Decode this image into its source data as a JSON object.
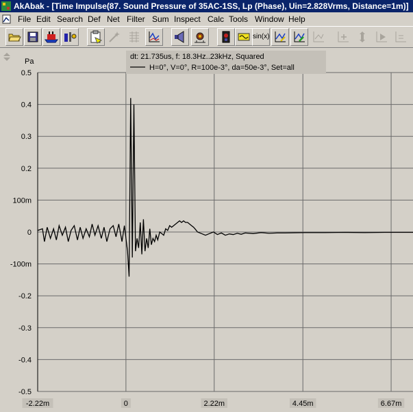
{
  "window": {
    "title": "AkAbak - [Time Impulse(87. Sound Pressure of 35AC-1SS, Lp (Phase), Uin=2.828Vrms, Distance=1m)]"
  },
  "menu": {
    "items": [
      "File",
      "Edit",
      "Search",
      "Def",
      "Net",
      "Filter",
      "Sum",
      "Inspect",
      "Calc",
      "Tools",
      "Window",
      "Help"
    ]
  },
  "toolbar": {
    "sinx_label": "sin(x)",
    "buttons": [
      {
        "name": "open-icon",
        "enabled": true
      },
      {
        "name": "save-icon",
        "enabled": true
      },
      {
        "name": "ship-icon",
        "enabled": true
      },
      {
        "name": "speaker-icon",
        "enabled": true
      },
      {
        "name": "clipboard-icon",
        "enabled": true
      },
      {
        "name": "wand-icon",
        "enabled": false
      },
      {
        "name": "grid-icon",
        "enabled": false
      },
      {
        "name": "graph-icon",
        "enabled": true
      },
      {
        "name": "driver-icon",
        "enabled": true
      },
      {
        "name": "speaker-box-icon",
        "enabled": true
      },
      {
        "name": "phone-icon",
        "enabled": true
      },
      {
        "name": "filter-icon",
        "enabled": true
      },
      {
        "name": "sinx-icon",
        "enabled": true
      },
      {
        "name": "arrow-graph-icon",
        "enabled": true
      },
      {
        "name": "green-graph-icon",
        "enabled": true
      },
      {
        "name": "pen-graph-icon",
        "enabled": false
      },
      {
        "name": "move-icon",
        "enabled": false
      },
      {
        "name": "zoom-icon",
        "enabled": false
      },
      {
        "name": "play-icon",
        "enabled": false
      },
      {
        "name": "export-icon",
        "enabled": false
      }
    ]
  },
  "colors": {
    "face": "#d4d0c8",
    "title_bar": "#0a246a",
    "grid": "#6a6a6a",
    "trace": "#000000",
    "legend_bg": "#c4c0b8"
  },
  "chart_data": {
    "type": "line",
    "ylabel": "Pa",
    "legend": {
      "header": "dt: 21.735us, f: 18.3Hz..23kHz, Squared",
      "series_name": "H=0°, V=0°, R=100e-3°, da=50e-3°, Set=all",
      "placement": "top-center"
    },
    "x_ticks": [
      {
        "value": -0.00222,
        "label": "-2.22m"
      },
      {
        "value": 0,
        "label": "0"
      },
      {
        "value": 0.00222,
        "label": "2.22m"
      },
      {
        "value": 0.00445,
        "label": "4.45m"
      },
      {
        "value": 0.00667,
        "label": "6.67m"
      }
    ],
    "y_ticks": [
      {
        "value": 0.5,
        "label": "0.5"
      },
      {
        "value": 0.4,
        "label": "0.4"
      },
      {
        "value": 0.3,
        "label": "0.3"
      },
      {
        "value": 0.2,
        "label": "0.2"
      },
      {
        "value": 0.1,
        "label": "100m"
      },
      {
        "value": 0,
        "label": "0"
      },
      {
        "value": -0.1,
        "label": "-100m"
      },
      {
        "value": -0.2,
        "label": "-0.2"
      },
      {
        "value": -0.3,
        "label": "-0.3"
      },
      {
        "value": -0.4,
        "label": "-0.4"
      },
      {
        "value": -0.5,
        "label": "-0.5"
      }
    ],
    "xlim": [
      -0.00222,
      0.00722
    ],
    "ylim": [
      -0.5,
      0.5
    ],
    "grid": true,
    "series": [
      {
        "x": [
          -0.00222,
          -0.0021,
          -0.00205,
          -0.00198,
          -0.0019,
          -0.00182,
          -0.00175,
          -0.00168,
          -0.0016,
          -0.00152,
          -0.00145,
          -0.00138,
          -0.0013,
          -0.00122,
          -0.00115,
          -0.00108,
          -0.001,
          -0.00092,
          -0.00085,
          -0.00078,
          -0.0007,
          -0.00062,
          -0.00055,
          -0.00048,
          -0.0004,
          -0.00032,
          -0.00025,
          -0.00018,
          -0.0001,
          -4e-05,
          0,
          4e-05,
          8e-05,
          0.00012,
          0.00016,
          0.0002,
          0.00024,
          0.00028,
          0.00032,
          0.00036,
          0.0004,
          0.00044,
          0.00048,
          0.00052,
          0.00056,
          0.0006,
          0.00064,
          0.00068,
          0.00072,
          0.00076,
          0.0008,
          0.00085,
          0.0009,
          0.00095,
          0.001,
          0.00105,
          0.0011,
          0.00115,
          0.0012,
          0.00125,
          0.0013,
          0.00135,
          0.0014,
          0.00145,
          0.0015,
          0.00155,
          0.0016,
          0.00165,
          0.0017,
          0.00175,
          0.0018,
          0.0019,
          0.002,
          0.0021,
          0.0022,
          0.0023,
          0.0024,
          0.0025,
          0.0026,
          0.0027,
          0.0028,
          0.0029,
          0.003,
          0.0032,
          0.0034,
          0.0036,
          0.0038,
          0.004,
          0.0045,
          0.005,
          0.0055,
          0.006,
          0.0065,
          0.007,
          0.00722
        ],
        "y": [
          0.005,
          0.01,
          -0.03,
          0.015,
          -0.02,
          0.01,
          -0.025,
          0.02,
          -0.01,
          0.015,
          -0.03,
          0.005,
          0.02,
          -0.025,
          0.015,
          -0.02,
          0.01,
          -0.015,
          0.025,
          -0.01,
          0.02,
          -0.02,
          0.015,
          -0.03,
          0.01,
          0.02,
          -0.015,
          0.025,
          -0.03,
          0.02,
          -0.02,
          -0.06,
          -0.14,
          0.42,
          -0.08,
          0.4,
          -0.06,
          -0.02,
          -0.05,
          0.03,
          -0.07,
          0.04,
          -0.06,
          -0.02,
          -0.05,
          0.01,
          -0.04,
          -0.02,
          -0.03,
          -0.01,
          -0.025,
          0.0,
          -0.005,
          -0.01,
          0.01,
          0.005,
          0.02,
          0.015,
          0.02,
          0.025,
          0.03,
          0.035,
          0.03,
          0.035,
          0.03,
          0.03,
          0.025,
          0.02,
          0.015,
          0.008,
          0.0,
          -0.005,
          -0.01,
          -0.005,
          0.0,
          -0.008,
          -0.003,
          -0.01,
          -0.006,
          -0.008,
          -0.004,
          -0.007,
          -0.003,
          -0.005,
          -0.002,
          -0.004,
          -0.003,
          -0.003,
          -0.002,
          -0.002,
          -0.001,
          -0.002,
          -0.001,
          -0.001,
          -0.001
        ]
      }
    ]
  }
}
